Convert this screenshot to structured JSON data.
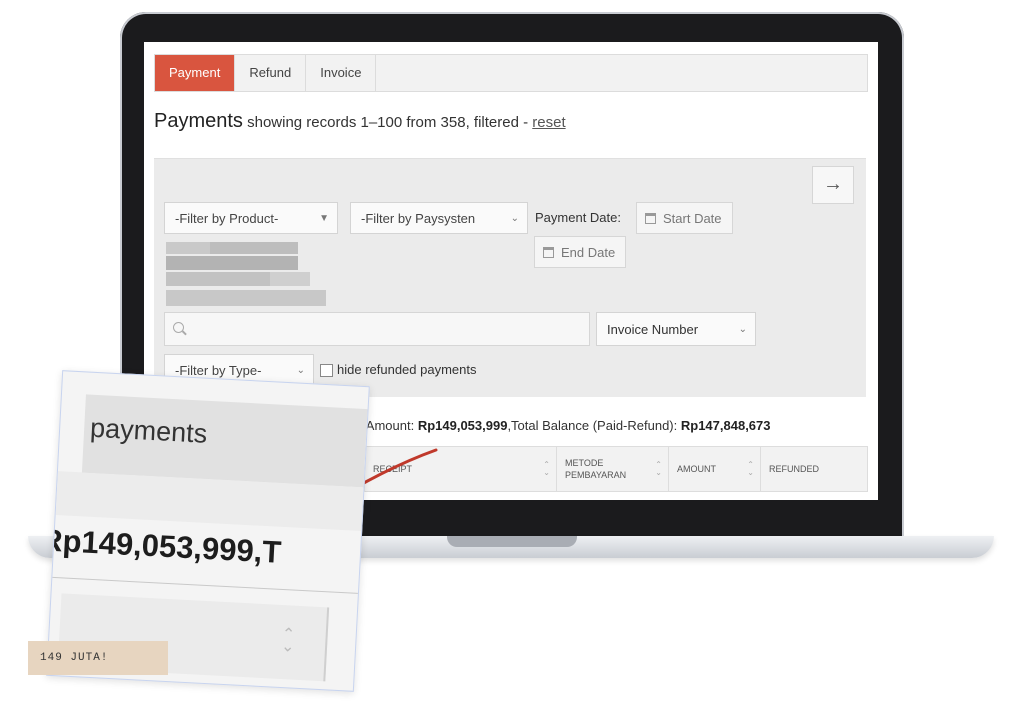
{
  "tabs": [
    {
      "label": "Payment",
      "active": true
    },
    {
      "label": "Refund",
      "active": false
    },
    {
      "label": "Invoice",
      "active": false
    }
  ],
  "heading": {
    "title": "Payments",
    "subtitle": " showing records 1–100 from 358, filtered - ",
    "reset_label": "reset"
  },
  "filters": {
    "next_icon": "arrow-right-icon",
    "product_select": "-Filter by Product-",
    "paysystem_select": "-Filter by Paysysten",
    "payment_date_label": "Payment Date:",
    "start_date": "Start Date",
    "end_date": "End Date",
    "search_placeholder": "",
    "search_field_select": "Invoice Number",
    "type_select": "-Filter by Type-",
    "hide_refunded_label": "hide refunded payments"
  },
  "summary": {
    "amount_label": "l Amount: ",
    "amount_value": "Rp149,053,999",
    "balance_label": ",Total Balance (Paid-Refund): ",
    "balance_value": "Rp147,848,673"
  },
  "table": {
    "headers": [
      "RECEIPT",
      "METODE PEMBAYARAN",
      "AMOUNT",
      "REFUNDED"
    ]
  },
  "zoom": {
    "word": "payments",
    "amount": "Rp149,053,999,T",
    "tag": "149 JUTA!"
  },
  "colors": {
    "accent": "#d9553f",
    "arrow": "#c0392b"
  }
}
